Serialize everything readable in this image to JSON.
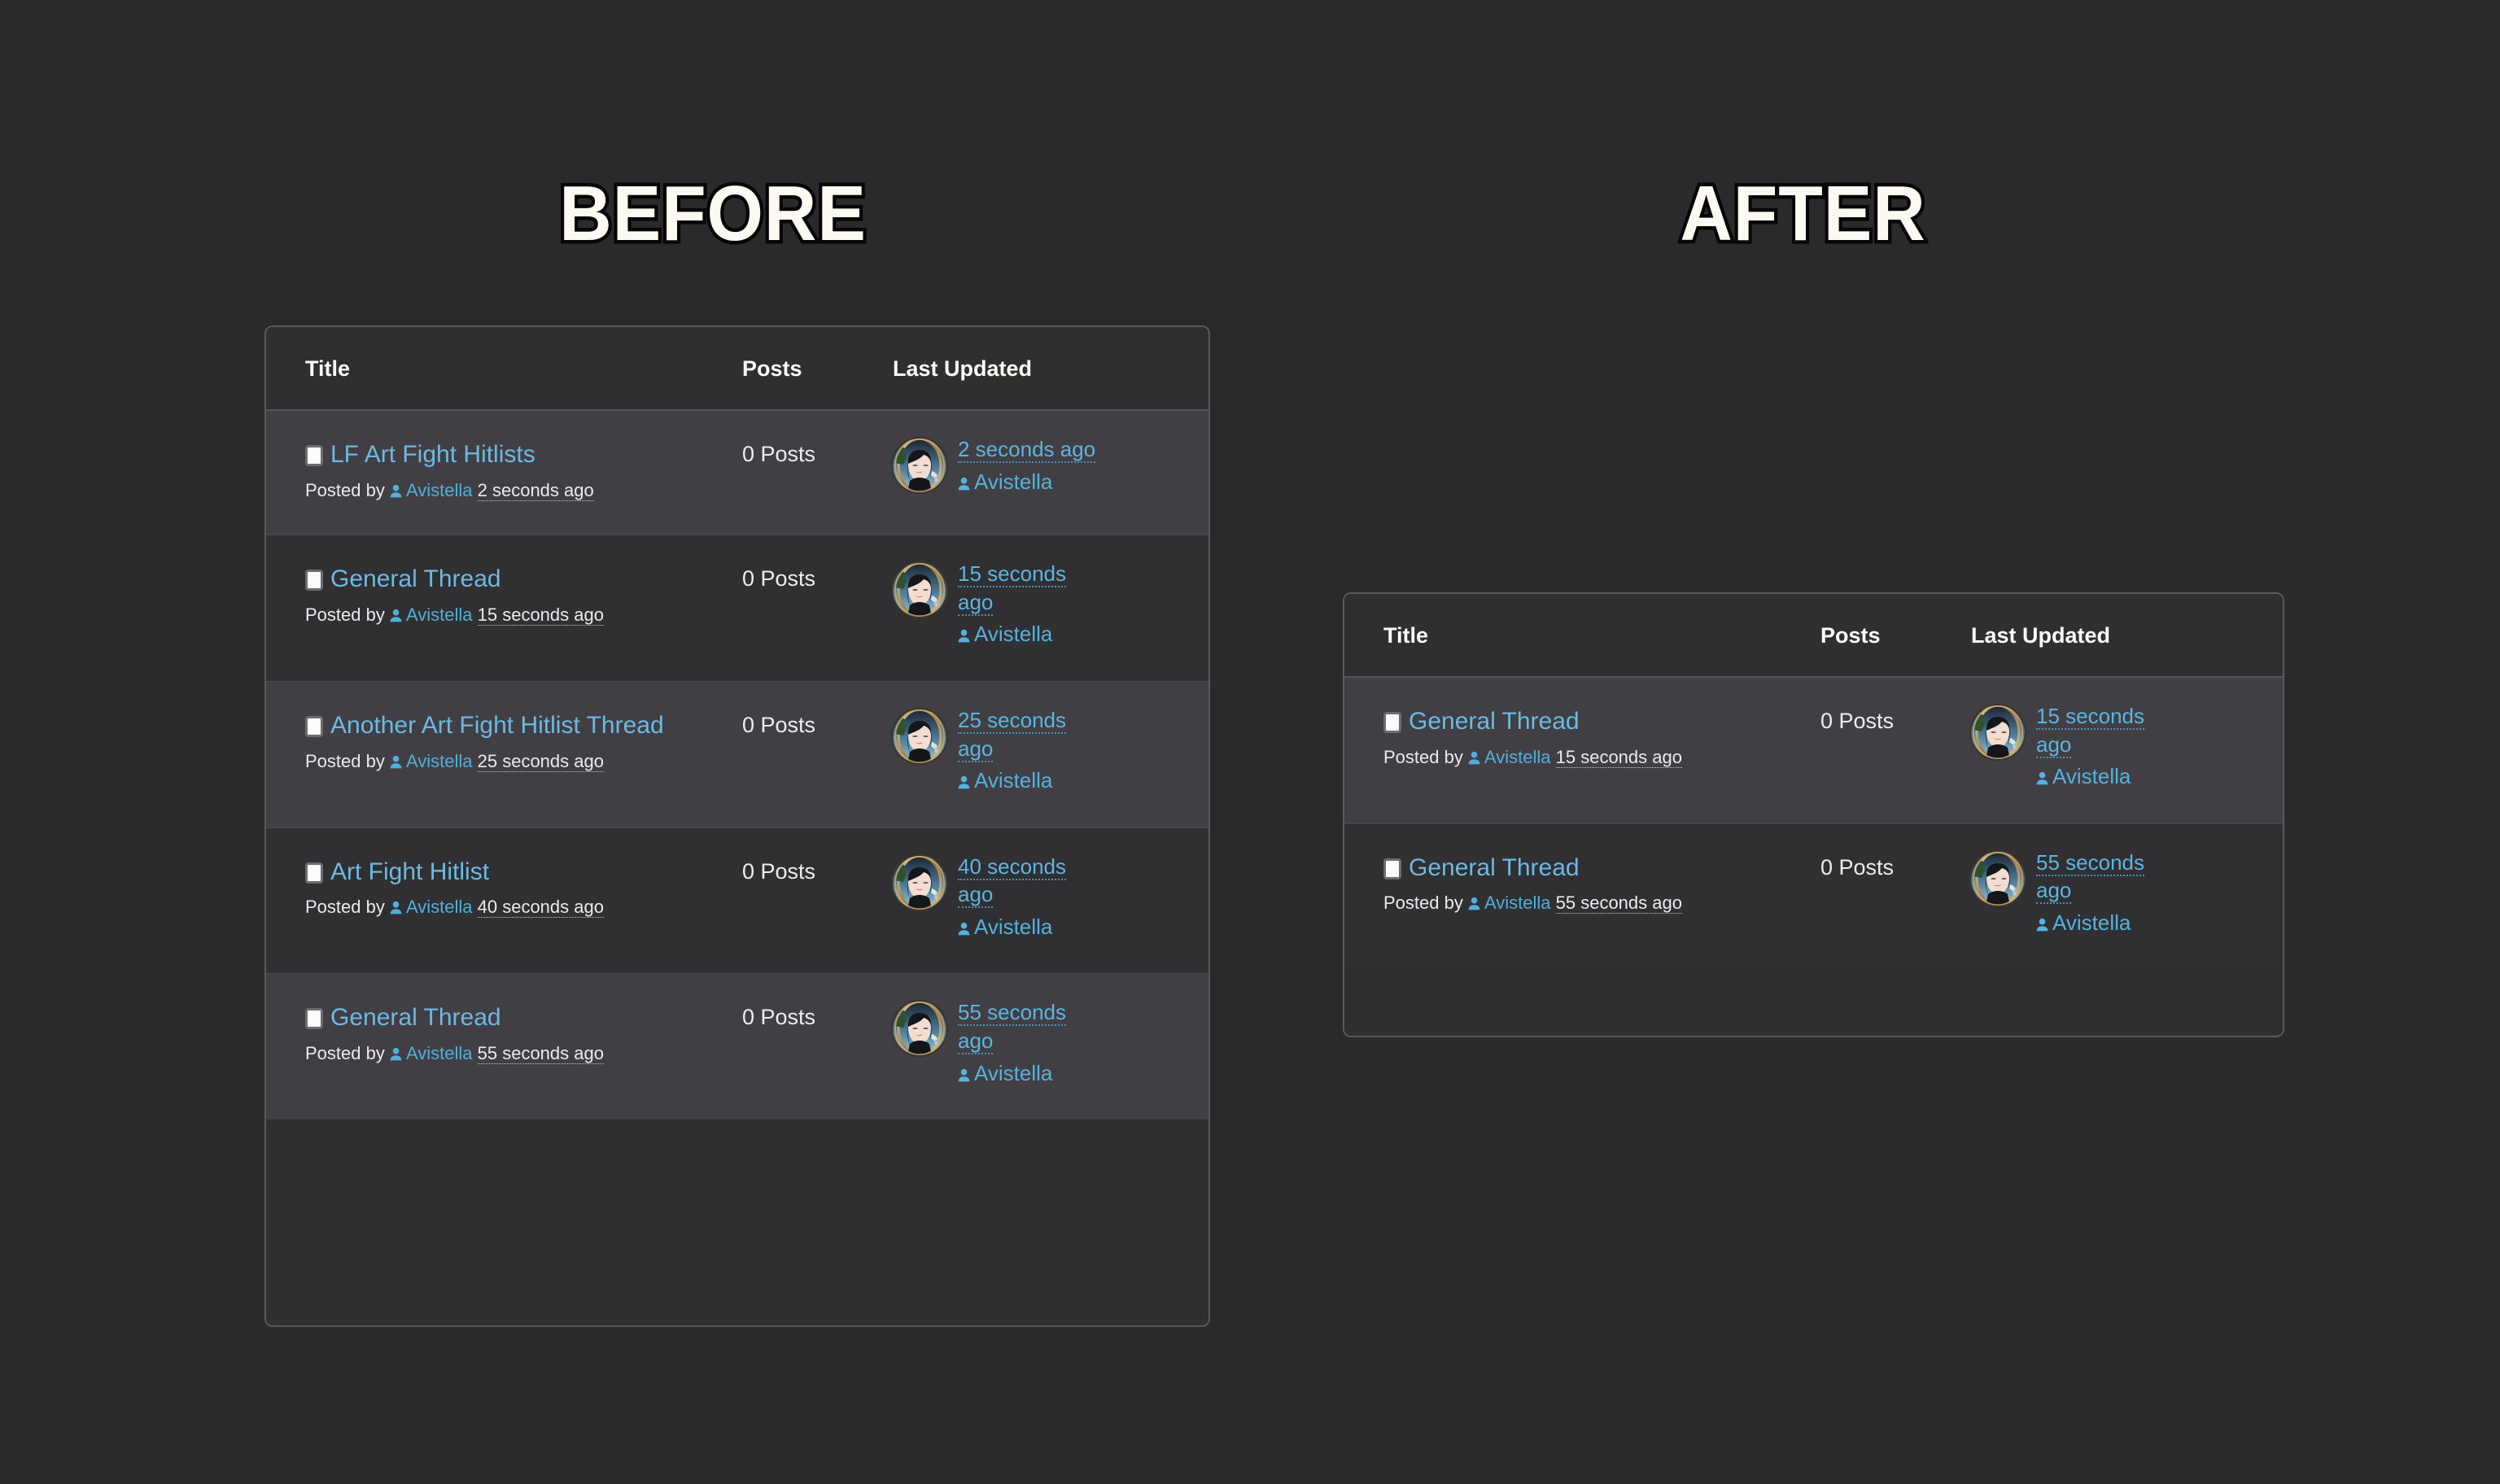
{
  "headings": {
    "before": "BEFORE",
    "after": "AFTER"
  },
  "columns": {
    "title": "Title",
    "posts": "Posts",
    "last_updated": "Last Updated"
  },
  "labels": {
    "posted_by": "Posted by",
    "note_icon": "note-icon",
    "user_icon": "user-icon",
    "avatar_alt": "Avistella avatar"
  },
  "colors": {
    "page_background": "#2b2a2b",
    "panel_background": "#2f2e30",
    "panel_border": "#5b585b",
    "row_odd": "#413f44",
    "row_even": "#302f31",
    "link_blue": "#6cb9e3",
    "author_blue": "#55b2dd",
    "text_light": "#eceaee",
    "heading_fill": "#fbf9f2",
    "heading_stroke": "#060606"
  },
  "before": {
    "rows": [
      {
        "title": "LF Art Fight Hitlists",
        "posts": "0 Posts",
        "author": "Avistella",
        "posted_time": "2 seconds ago",
        "updated_time": "2 seconds ago",
        "updated_author": "Avistella"
      },
      {
        "title": "General Thread",
        "posts": "0 Posts",
        "author": "Avistella",
        "posted_time": "15 seconds ago",
        "updated_time": "15 seconds ago",
        "updated_author": "Avistella"
      },
      {
        "title": "Another Art Fight Hitlist Thread",
        "posts": "0 Posts",
        "author": "Avistella",
        "posted_time": "25 seconds ago",
        "updated_time": "25 seconds ago",
        "updated_author": "Avistella"
      },
      {
        "title": "Art Fight Hitlist",
        "posts": "0 Posts",
        "author": "Avistella",
        "posted_time": "40 seconds ago",
        "updated_time": "40 seconds ago",
        "updated_author": "Avistella"
      },
      {
        "title": "General Thread",
        "posts": "0 Posts",
        "author": "Avistella",
        "posted_time": "55 seconds ago",
        "updated_time": "55 seconds ago",
        "updated_author": "Avistella"
      }
    ]
  },
  "after": {
    "rows": [
      {
        "title": "General Thread",
        "posts": "0 Posts",
        "author": "Avistella",
        "posted_time": "15 seconds ago",
        "updated_time": "15 seconds ago",
        "updated_author": "Avistella"
      },
      {
        "title": "General Thread",
        "posts": "0 Posts",
        "author": "Avistella",
        "posted_time": "55 seconds ago",
        "updated_time": "55 seconds ago",
        "updated_author": "Avistella"
      }
    ]
  }
}
